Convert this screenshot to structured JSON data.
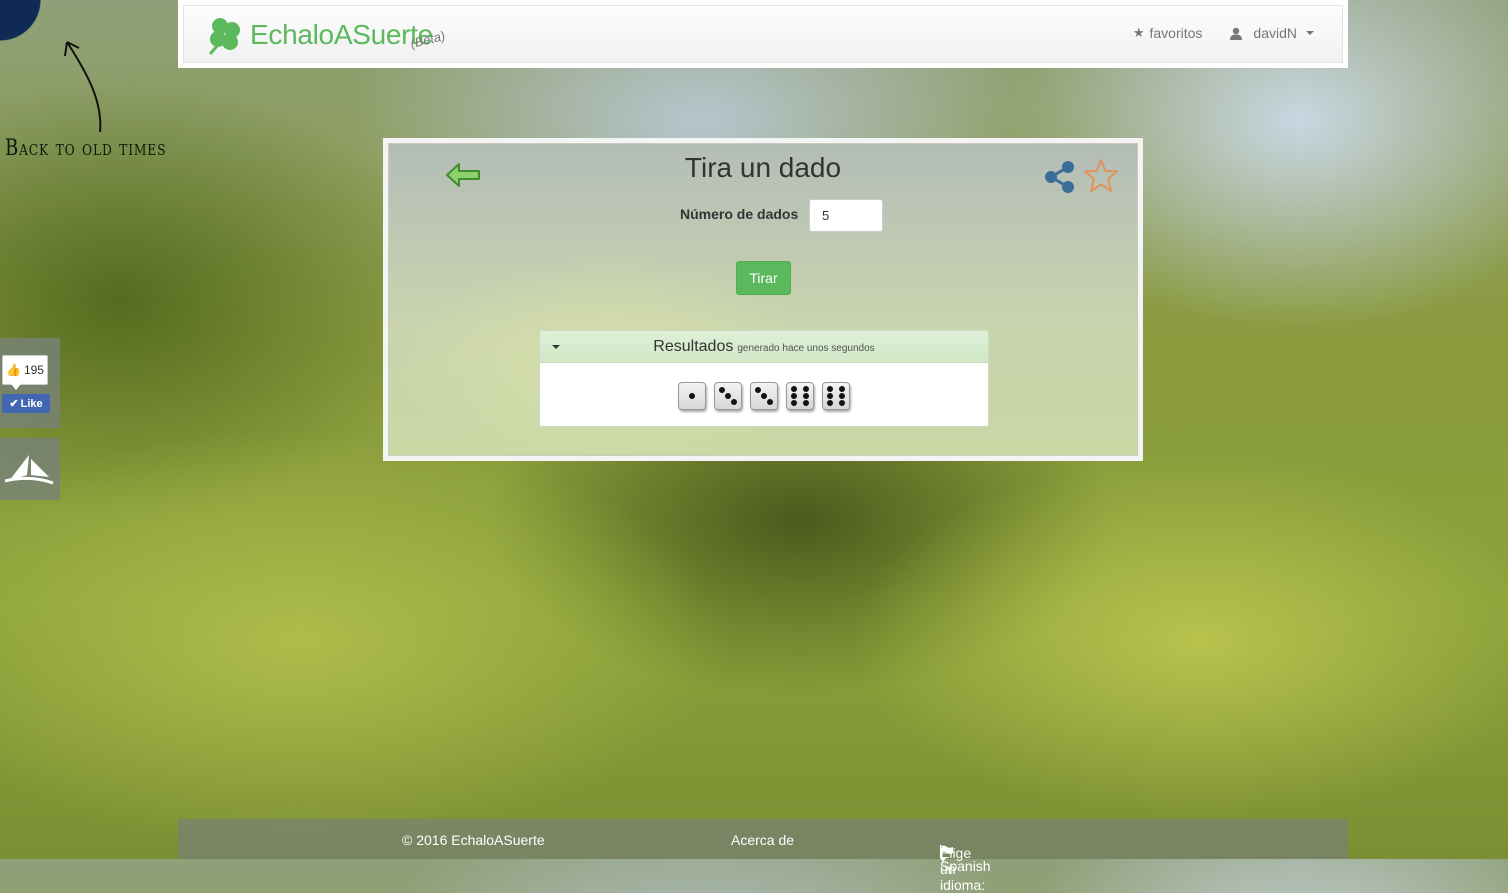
{
  "corner": {
    "text": "Back to old times"
  },
  "navbar": {
    "brand": "EchaloASuerte",
    "beta": "(Beta)",
    "favorites_label": "favoritos",
    "user_label": "davidN"
  },
  "social": {
    "like_count": "195",
    "like_label": "Like"
  },
  "panel": {
    "title": "Tira un dado",
    "field_label": "Número de dados",
    "field_value": "5",
    "submit_label": "Tirar",
    "results_title": "Resultados",
    "results_subtitle": "generado hace unos segundos",
    "dice_values": [
      1,
      3,
      3,
      6,
      6
    ]
  },
  "footer": {
    "copyright": "© 2016 EchaloASuerte",
    "about": "Acerca de",
    "language_prompt": "Elige un idioma:",
    "language_value": "Spanish"
  },
  "colors": {
    "brand_green": "#5cb85c",
    "share_blue": "#3a6e99",
    "star_orange": "#e0935a"
  }
}
